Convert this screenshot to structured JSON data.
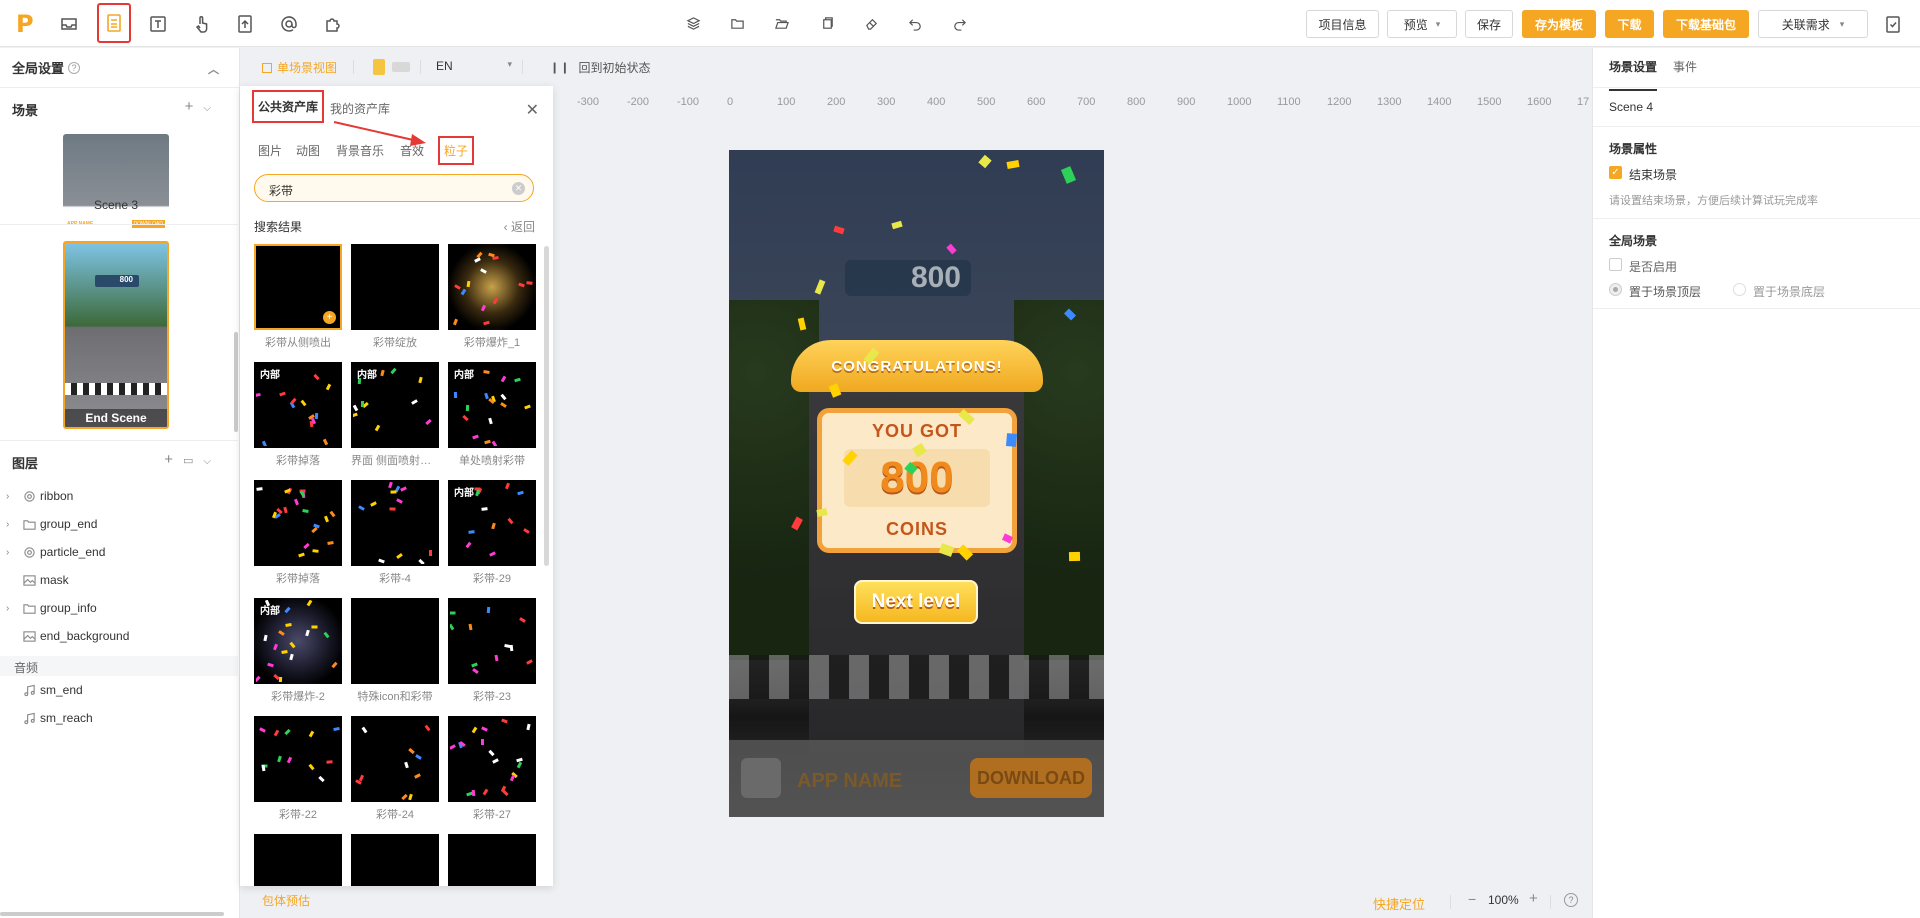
{
  "toolbar": {
    "logo": "P",
    "left_icons": [
      "inbox-icon",
      "layout-icon",
      "text-icon",
      "gesture-icon",
      "upload-icon",
      "mention-icon",
      "plugin-icon"
    ],
    "mid_icons": [
      "layers-icon",
      "folder-icon",
      "folder-open-icon",
      "copy-icon",
      "eraser-icon",
      "undo-icon",
      "redo-icon"
    ],
    "project_info": "项目信息",
    "preview": "预览",
    "save": "保存",
    "save_template": "存为模板",
    "download": "下载",
    "download_base": "下载基础包",
    "related": "关联需求",
    "accent": "#f5a623"
  },
  "left": {
    "global_settings": "全局设置",
    "scenes_title": "场景",
    "scene3_label": "Scene 3",
    "end_scene_label": "End Scene",
    "scene_thumb_score": "800",
    "scene_app_name": "APP NAME",
    "scene_download": "DOWNLOAD",
    "layers_title": "图层",
    "layers": [
      {
        "name": "ribbon",
        "icon": "particle-icon",
        "expandable": true
      },
      {
        "name": "group_end",
        "icon": "folder-icon",
        "expandable": true
      },
      {
        "name": "particle_end",
        "icon": "particle-icon",
        "expandable": true
      },
      {
        "name": "mask",
        "icon": "image-icon",
        "expandable": false
      },
      {
        "name": "group_info",
        "icon": "folder-icon",
        "expandable": true
      },
      {
        "name": "end_background",
        "icon": "image-icon",
        "expandable": false
      }
    ],
    "audio_title": "音频",
    "audio": [
      {
        "name": "sm_end",
        "icon": "music-icon"
      },
      {
        "name": "sm_reach",
        "icon": "music-icon"
      }
    ]
  },
  "canvas": {
    "view_label": "单场景视图",
    "lang": "EN",
    "reset_label": "回到初始状态",
    "ruler": [
      "-300",
      "-200",
      "-100",
      "0",
      "100",
      "200",
      "300",
      "400",
      "500",
      "600",
      "700",
      "800",
      "900",
      "1000",
      "1100",
      "1200",
      "1300",
      "1400",
      "1500",
      "1600",
      "17"
    ],
    "game": {
      "score_top": "800",
      "congrats": "CONGRATULATIONS!",
      "you_got": "YOU GOT",
      "amount": "800",
      "coins": "COINS",
      "next": "Next level",
      "app_name": "APP NAME",
      "download": "DOWNLOAD"
    }
  },
  "assets": {
    "tab_public": "公共资产库",
    "tab_mine": "我的资产库",
    "categories": [
      "图片",
      "动图",
      "背景音乐",
      "音效",
      "粒子"
    ],
    "search_value": "彩带",
    "results_title": "搜索结果",
    "back": "返回",
    "inner_badge": "内部",
    "items": [
      {
        "label": "彩带从侧喷出",
        "inner": false
      },
      {
        "label": "彩带绽放",
        "inner": false
      },
      {
        "label": "彩带爆炸_1",
        "inner": false
      },
      {
        "label": "彩带掉落",
        "inner": true
      },
      {
        "label": "界面 侧面喷射彩带",
        "inner": true
      },
      {
        "label": "单处喷射彩带",
        "inner": true
      },
      {
        "label": "彩带掉落",
        "inner": false
      },
      {
        "label": "彩带-4",
        "inner": false
      },
      {
        "label": "彩带-29",
        "inner": true
      },
      {
        "label": "彩带爆炸-2",
        "inner": true
      },
      {
        "label": "特殊icon和彩带",
        "inner": false
      },
      {
        "label": "彩带-23",
        "inner": false
      },
      {
        "label": "彩带-22",
        "inner": false
      },
      {
        "label": "彩带-24",
        "inner": false
      },
      {
        "label": "彩带-27",
        "inner": false
      }
    ]
  },
  "right": {
    "tab_scene": "场景设置",
    "tab_event": "事件",
    "scene_name": "Scene 4",
    "props_title": "场景属性",
    "end_scene_check": "结束场景",
    "end_scene_hint": "请设置结束场景，方便后续计算试玩完成率",
    "global_scene_title": "全局场景",
    "enable": "是否启用",
    "top_layer": "置于场景顶层",
    "bottom_layer": "置于场景底层"
  },
  "bottom": {
    "estimate": "包体预估",
    "locate": "快捷定位",
    "zoom": "100%"
  }
}
